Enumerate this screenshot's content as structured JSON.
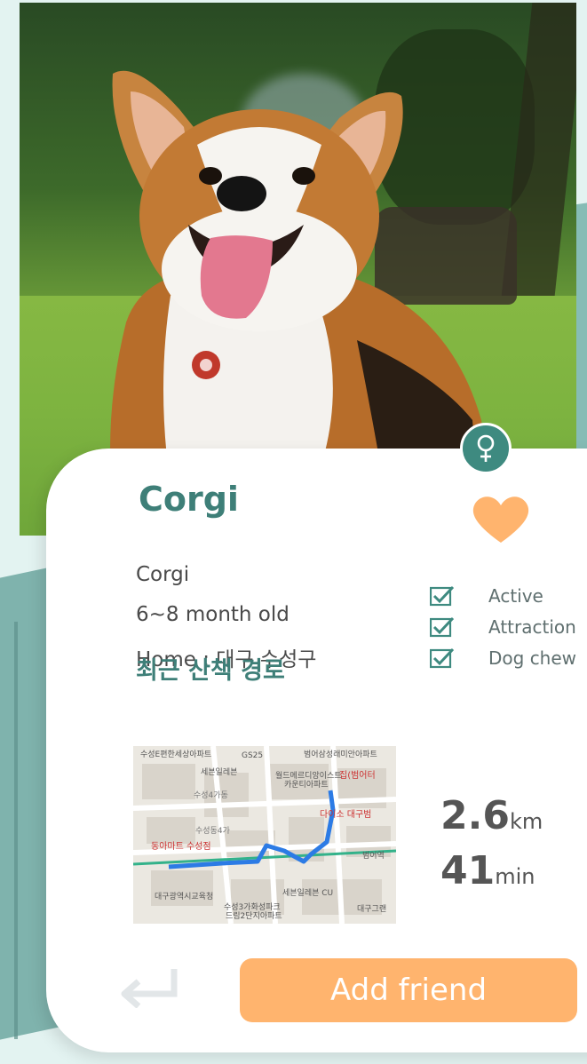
{
  "profile": {
    "name": "Corgi",
    "breed": "Corgi",
    "age": "6~8 month old",
    "home": "Home : 대구 수성구",
    "gender_icon": "female-icon",
    "favorite_icon": "heart-icon"
  },
  "traits": [
    {
      "label": "Active",
      "checked": true
    },
    {
      "label": "Attraction",
      "checked": true
    },
    {
      "label": "Dog chew",
      "checked": true
    }
  ],
  "walk": {
    "title": "최근 산책 경로",
    "distance_value": "2.6",
    "distance_unit": "km",
    "duration_value": "41",
    "duration_unit": "min",
    "map_labels": [
      "수성E편한세상아파트",
      "GS25",
      "범어삼성래미안아파트",
      "세븐일레븐",
      "월드메르디앙이스트",
      "카운티아파트",
      "집(범어터",
      "수성4가동",
      "다이소 대구범",
      "수성동4가",
      "동아마트 수성점",
      "범어역",
      "대구광역시교육청",
      "세븐일레븐 CU",
      "수성3가화성파크",
      "드림2단지아파트",
      "대구그랜"
    ]
  },
  "actions": {
    "back_icon": "return-arrow-icon",
    "add_friend": "Add friend"
  },
  "colors": {
    "accent_teal": "#3e7f78",
    "accent_orange": "#ffb46e",
    "background": "#e3f3f1"
  }
}
